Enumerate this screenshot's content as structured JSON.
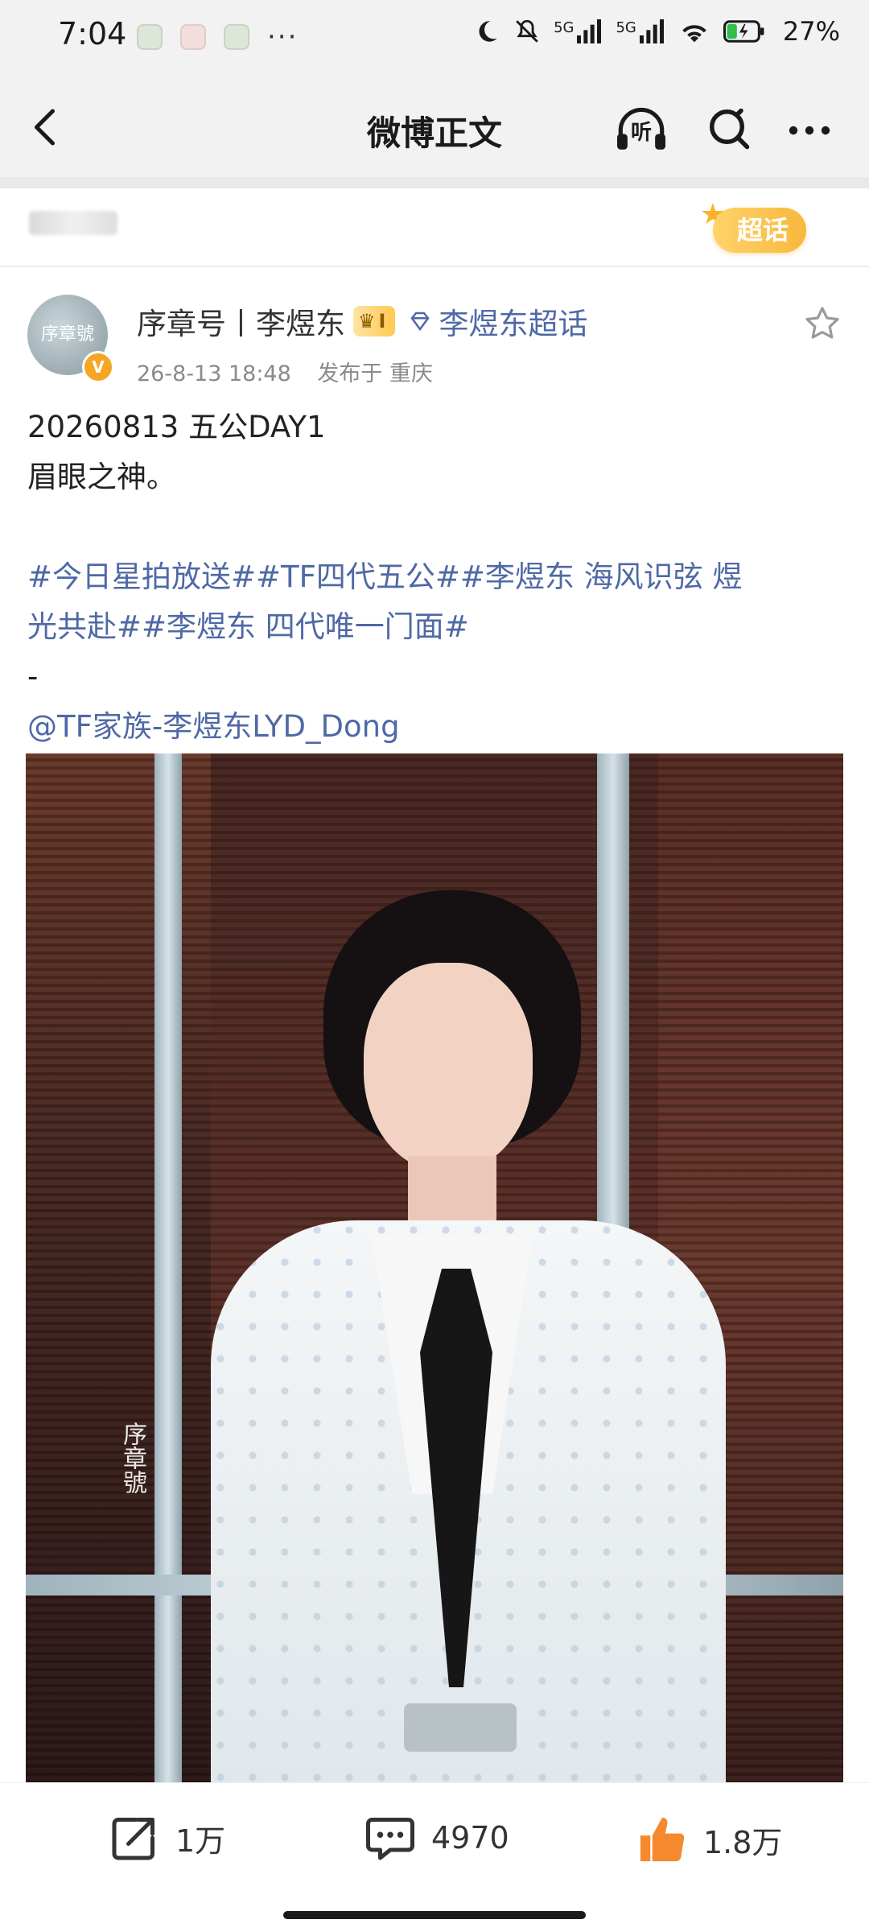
{
  "status_bar": {
    "time": "7:04",
    "more": "···",
    "network1": "5G",
    "network2": "5G",
    "battery": "27%"
  },
  "header": {
    "title": "微博正文",
    "listen_label": "听"
  },
  "super_topic": {
    "badge_label": "超话"
  },
  "post": {
    "author": "序章号丨李煜东",
    "member_level": "I",
    "topic": "李煜东超话",
    "timestamp": "26-8-13 18:48",
    "location": "发布于 重庆",
    "line1": "20260813 五公DAY1",
    "line2": "眉眼之神。",
    "hashtags_line1": "#今日星拍放送##TF四代五公##李煜东 海风识弦 煜",
    "hashtags_line2": "光共赴##李煜东 四代唯一门面#",
    "dash": "-",
    "mention": "@TF家族-李煜东LYD_Dong",
    "avatar_text": "序章號",
    "watermark": "序章號"
  },
  "actions": {
    "reposts": "1万",
    "comments": "4970",
    "likes": "1.8万"
  },
  "colors": {
    "link": "#4f69a6",
    "like": "#f5892e"
  }
}
